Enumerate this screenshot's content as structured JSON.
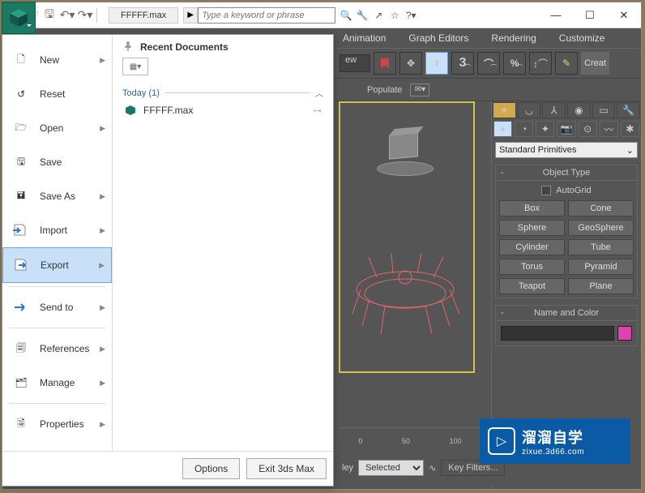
{
  "title": "FFFFF.max",
  "search_placeholder": "Type a keyword or phrase",
  "menubar": [
    "Animation",
    "Graph Editors",
    "Rendering",
    "Customize"
  ],
  "toolbar2": {
    "view": "ew",
    "create_label": "Creat"
  },
  "toolbar3": {
    "populate": "Populate"
  },
  "appmenu": {
    "items": [
      {
        "label": "New",
        "arrow": true
      },
      {
        "label": "Reset",
        "arrow": false
      },
      {
        "label": "Open",
        "arrow": true
      },
      {
        "label": "Save",
        "arrow": false
      },
      {
        "label": "Save As",
        "arrow": true
      },
      {
        "label": "Import",
        "arrow": true
      },
      {
        "label": "Export",
        "arrow": true,
        "selected": true
      },
      {
        "label": "Send to",
        "arrow": true
      },
      {
        "label": "References",
        "arrow": true
      },
      {
        "label": "Manage",
        "arrow": true
      },
      {
        "label": "Properties",
        "arrow": true
      }
    ],
    "recent_header": "Recent Documents",
    "group": "Today (1)",
    "recent": "FFFFF.max",
    "footer": {
      "options": "Options",
      "exit": "Exit 3ds Max"
    }
  },
  "cmdpanel": {
    "dropdown": "Standard Primitives",
    "rollup1": "Object Type",
    "autogrid": "AutoGrid",
    "prims": [
      "Box",
      "Cone",
      "Sphere",
      "GeoSphere",
      "Cylinder",
      "Tube",
      "Torus",
      "Pyramid",
      "Teapot",
      "Plane"
    ],
    "rollup2": "Name and Color"
  },
  "timeline": [
    "0",
    "50",
    "100"
  ],
  "statusbar": {
    "select_mode": "Selected",
    "keyfilters": "Key Filters...",
    "ley": "ley"
  },
  "watermark": {
    "cn": "溜溜自学",
    "url": "zixue.3d66.com"
  }
}
